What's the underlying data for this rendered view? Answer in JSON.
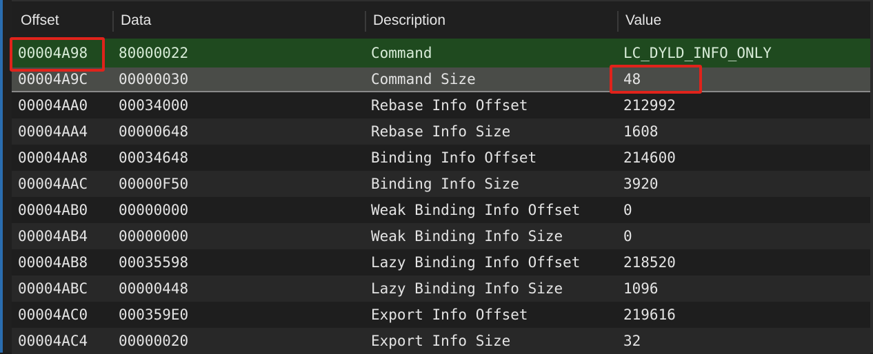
{
  "columns": [
    "Offset",
    "Data",
    "Description",
    "Value"
  ],
  "rows": [
    [
      "00004A98",
      "80000022",
      "Command",
      "LC_DYLD_INFO_ONLY"
    ],
    [
      "00004A9C",
      "00000030",
      "Command Size",
      "48"
    ],
    [
      "00004AA0",
      "00034000",
      "Rebase Info Offset",
      "212992"
    ],
    [
      "00004AA4",
      "00000648",
      "Rebase Info Size",
      "1608"
    ],
    [
      "00004AA8",
      "00034648",
      "Binding Info Offset",
      "214600"
    ],
    [
      "00004AAC",
      "00000F50",
      "Binding Info Size",
      "3920"
    ],
    [
      "00004AB0",
      "00000000",
      "Weak Binding Info Offset",
      "0"
    ],
    [
      "00004AB4",
      "00000000",
      "Weak Binding Info Size",
      "0"
    ],
    [
      "00004AB8",
      "00035598",
      "Lazy Binding Info Offset",
      "218520"
    ],
    [
      "00004ABC",
      "00000448",
      "Lazy Binding Info Size",
      "1096"
    ],
    [
      "00004AC0",
      "000359E0",
      "Export Info Offset",
      "219616"
    ],
    [
      "00004AC4",
      "00000020",
      "Export Info Size",
      "32"
    ]
  ],
  "colors": {
    "selected_row": "#1f4a1f",
    "highlight": "#e0231b"
  }
}
